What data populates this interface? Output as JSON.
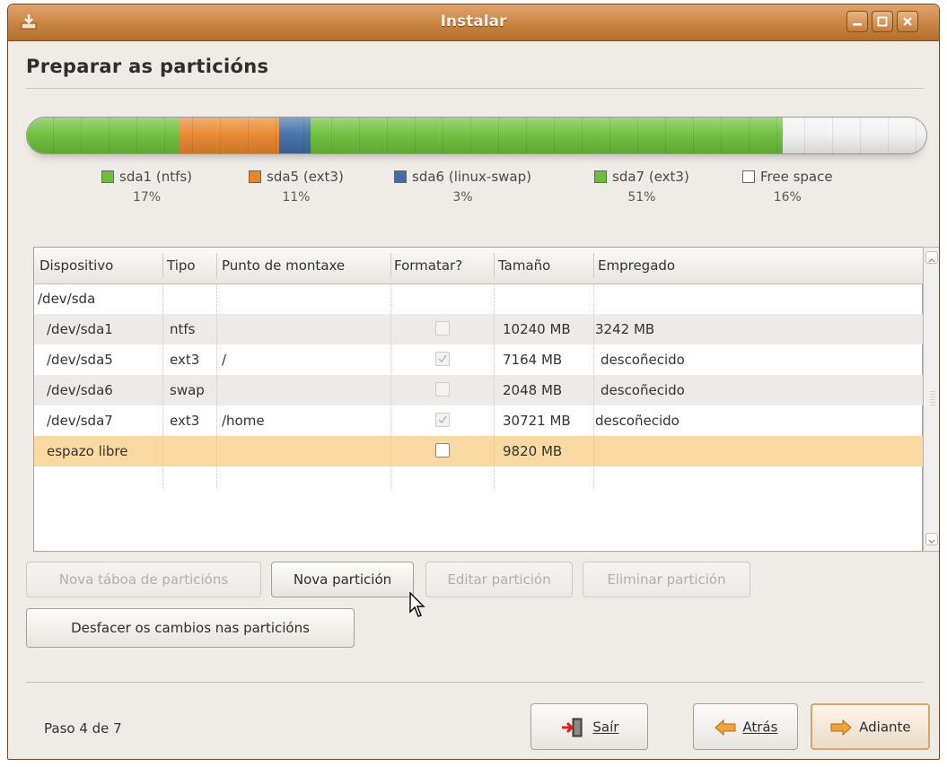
{
  "window": {
    "title": "Instalar"
  },
  "page": {
    "title": "Preparar as particións"
  },
  "colors": {
    "accent": "#c9843f",
    "ntfs": "#6bbf3a",
    "ext3": "#e8862b",
    "swap": "#3f6ea8",
    "ext3_home": "#6bbf3a",
    "free": "#f2f2f2",
    "selected_row": "#f9d9a2"
  },
  "partitions_bar": [
    {
      "label": "sda1 (ntfs)",
      "percent_text": "17%",
      "share": 17,
      "color": "#6bbf3a"
    },
    {
      "label": "sda5 (ext3)",
      "percent_text": "11%",
      "share": 11,
      "color": "#e8862b"
    },
    {
      "label": "sda6 (linux-swap)",
      "percent_text": "3%",
      "share": 3.5,
      "color": "#3f6ea8"
    },
    {
      "label": "sda7 (ext3)",
      "percent_text": "51%",
      "share": 52.5,
      "color": "#6bbf3a"
    },
    {
      "label": "Free space",
      "percent_text": "16%",
      "share": 16,
      "color": "#f2f2f2"
    }
  ],
  "table": {
    "columns": [
      "Dispositivo",
      "Tipo",
      "Punto de montaxe",
      "Formatar?",
      "Tamaño",
      "Empregado"
    ],
    "rows": [
      {
        "device": "/dev/sda",
        "type": "",
        "mount": "",
        "format": null,
        "size": "",
        "used": ""
      },
      {
        "device": "/dev/sda1",
        "type": "ntfs",
        "mount": "",
        "format": false,
        "size": "10240 MB",
        "used": "3242 MB"
      },
      {
        "device": "/dev/sda5",
        "type": "ext3",
        "mount": "/",
        "format": true,
        "size": "7164 MB",
        "used": "descoñecido"
      },
      {
        "device": "/dev/sda6",
        "type": "swap",
        "mount": "",
        "format": false,
        "size": "2048 MB",
        "used": "descoñecido"
      },
      {
        "device": "/dev/sda7",
        "type": "ext3",
        "mount": "/home",
        "format": true,
        "size": "30721 MB",
        "used": "descoñecido"
      },
      {
        "device": "espazo libre",
        "type": "",
        "mount": "",
        "format": false,
        "size": "9820 MB",
        "used": ""
      }
    ]
  },
  "actions": {
    "new_table": "Nova táboa de particións",
    "new_partition": "Nova partición",
    "edit_partition": "Editar partición",
    "delete_partition": "Eliminar partición",
    "undo": "Desfacer os cambios nas particións"
  },
  "footer": {
    "step": "Paso 4 de 7",
    "quit": "Saír",
    "back": "Atrás",
    "forward": "Adiante"
  }
}
